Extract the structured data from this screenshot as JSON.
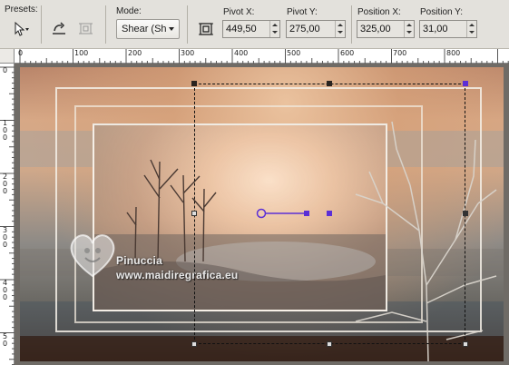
{
  "toolbar": {
    "presets_label": "Presets:",
    "mode_label": "Mode:",
    "mode_value": "Shear (Sh",
    "pivot_x_label": "Pivot X:",
    "pivot_x_value": "449,50",
    "pivot_y_label": "Pivot Y:",
    "pivot_y_value": "275,00",
    "position_x_label": "Position X:",
    "position_x_value": "325,00",
    "position_y_label": "Position Y:",
    "position_y_value": "31,00",
    "icons": [
      "pick-tool-arrow-icon",
      "reset-transform-icon",
      "apply-icon",
      "pivot-icon"
    ]
  },
  "ruler": {
    "top_labels": [
      "0",
      "100",
      "200",
      "300",
      "400",
      "500",
      "600",
      "700",
      "800"
    ],
    "left_labels": [
      "0",
      "1\n0\n0",
      "2\n0\n0",
      "3\n0\n0",
      "4\n0\n0",
      "5\n0"
    ]
  },
  "canvas": {
    "watermark_line1": "Pinuccia",
    "watermark_line2": "www.maidiregrafica.eu",
    "colors": {
      "selection_box": "#000000",
      "handle_accent": "#5b2fd6",
      "frame_border": "#f5f0e8"
    }
  }
}
